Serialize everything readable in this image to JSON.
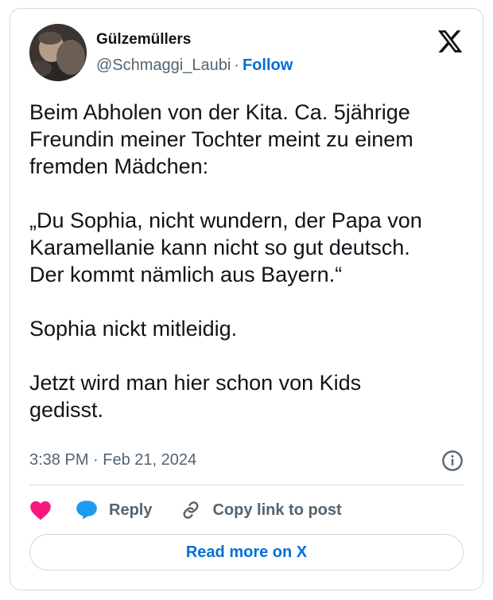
{
  "author": {
    "name": "Gülzemüllers",
    "handle": "@Schmaggi_Laubi",
    "separator": "·",
    "follow_label": "Follow"
  },
  "tweet": {
    "text": "Beim Abholen von der Kita. Ca. 5jährige\nFreundin meiner Tochter meint zu einem\nfremden Mädchen:\n\n„Du Sophia, nicht wundern, der Papa von\nKaramellanie kann nicht so gut deutsch.\nDer kommt nämlich aus Bayern.“\n\nSophia nickt mitleidig.\n\nJetzt wird man hier schon von Kids\ngedisst.",
    "timestamp": "3:38 PM · Feb 21, 2024"
  },
  "actions": {
    "reply_label": "Reply",
    "copy_label": "Copy link to post"
  },
  "footer": {
    "read_more_label": "Read more on X"
  },
  "icons": {
    "logo": "x-logo-icon",
    "info": "info-icon",
    "like": "heart-icon",
    "reply": "speech-bubble-icon",
    "copy": "link-icon"
  },
  "colors": {
    "text": "#0f1419",
    "secondary": "#536471",
    "link": "#006fd6",
    "heart": "#f91880",
    "reply_bubble": "#1d9bf0",
    "border": "#cfd9de"
  }
}
